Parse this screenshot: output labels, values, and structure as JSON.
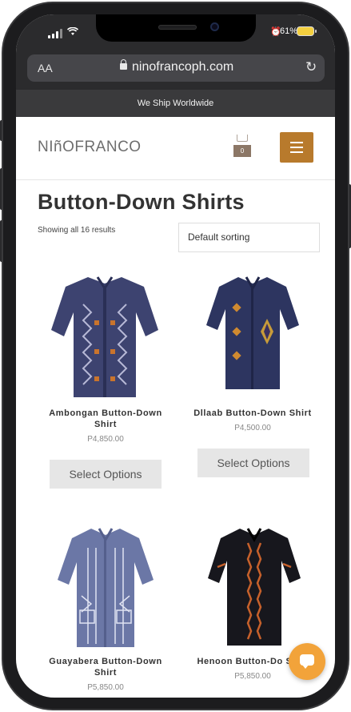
{
  "status": {
    "battery": "61%"
  },
  "browser": {
    "aa_label": "AA",
    "url": "ninofrancoph.com"
  },
  "banner": "We Ship Worldwide",
  "header": {
    "logo": "NIñOFRANCO",
    "cart_count": "0"
  },
  "page": {
    "title": "Button-Down Shirts",
    "results": "Showing all 16 results",
    "sort_selected": "Default sorting"
  },
  "products": [
    {
      "name": "Ambongan Button-Down Shirt",
      "price": "P4,850.00",
      "button": "Select Options",
      "color": "#3d4370"
    },
    {
      "name": "Dllaab Button-Down Shirt",
      "price": "P4,500.00",
      "button": "Select Options",
      "color": "#2d3560"
    },
    {
      "name": "Guayabera Button-Down Shirt",
      "price": "P5,850.00",
      "color": "#6b77a6"
    },
    {
      "name": "Henoon Button-Do Shirt",
      "price": "P5,850.00",
      "color": "#17171d"
    }
  ],
  "colors": {
    "accent": "#b87a2c",
    "chat": "#f2a33a",
    "banner_bg": "#3a3a3c"
  },
  "icons": [
    "signal-icon",
    "wifi-icon",
    "alarm-icon",
    "battery-icon",
    "lock-icon",
    "reload-icon",
    "cart-icon",
    "hamburger-icon",
    "chat-icon"
  ]
}
